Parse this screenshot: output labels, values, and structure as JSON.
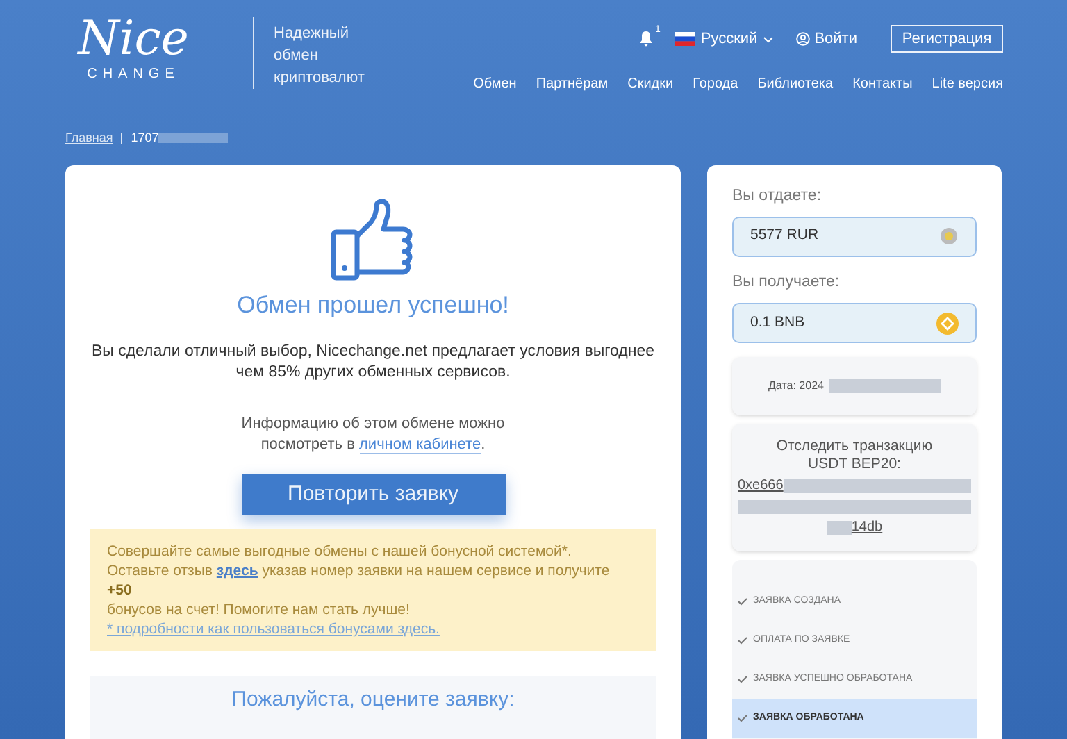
{
  "header": {
    "logo": {
      "word": "Nice",
      "sub": "CHANGE"
    },
    "tagline": [
      "Надежный",
      "обмен",
      "криптовалют"
    ],
    "notifications": "1",
    "language": "Русский",
    "login": "Войти",
    "register": "Регистрация",
    "nav": [
      "Обмен",
      "Партнёрам",
      "Скидки",
      "Города",
      "Библиотека",
      "Контакты",
      "Lite версия"
    ]
  },
  "breadcrumb": {
    "home": "Главная",
    "current": "1707"
  },
  "result": {
    "title": "Обмен прошел успешно!",
    "text": "Вы сделали отличный выбор, Nicechange.net предлагает условия выгоднее чем 85% других обменных сервисов.",
    "info": "Информацию об этом обмене можно посмотреть в",
    "info_link": "личном кабинете",
    "info_end": ".",
    "repeat_button": "Повторить заявку",
    "bonus": {
      "line1": "Совершайте самые выгодные обмены с нашей бонусной системой*.",
      "line2_before": "Оставьте отзыв",
      "line2_link": "здесь",
      "line2_after": "указав номер заявки на нашем сервисе и получите",
      "amount": "+50",
      "line3": "бонусов на счет! Помогите нам стать лучше!",
      "details_link": "* подробности как пользоваться бонусами здесь."
    },
    "rate_title": "Пожалуйста, оцените заявку:"
  },
  "order": {
    "give_label": "Вы отдаете:",
    "give_value": "5577 RUR",
    "get_label": "Вы получаете:",
    "get_value": "0.1 BNB",
    "date": "Дата: 2024",
    "track_label": "Отследить транзакцию USDT BEP20:",
    "hash_start": "0xe666",
    "hash_end": "14db",
    "steps": [
      {
        "label": "ЗАЯВКА СОЗДАНА",
        "selected": false
      },
      {
        "label": "ОПЛАТА ПО ЗАЯВКЕ",
        "selected": false
      },
      {
        "label": "ЗАЯВКА УСПЕШНО ОБРАБОТАНА",
        "selected": false
      },
      {
        "label": "ЗАЯВКА ОБРАБОТАНА",
        "selected": true
      }
    ]
  }
}
